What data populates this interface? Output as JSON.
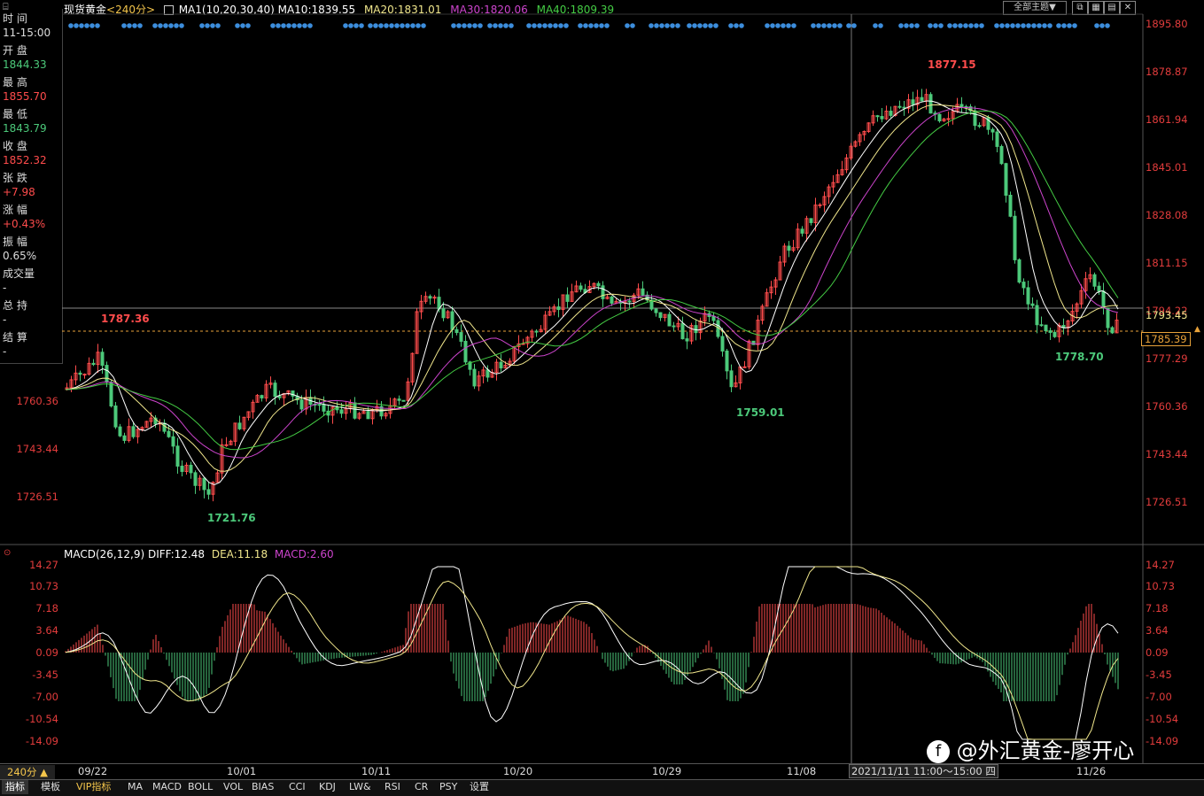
{
  "header": {
    "symbol": "现货黄金",
    "period": "<240分>",
    "ma_label": "MA1(10,20,30,40)",
    "ma10": "MA10:1839.55",
    "ma20": "MA20:1831.01",
    "ma30": "MA30:1820.06",
    "ma40": "MA40:1809.39",
    "theme_select": "全部主题▼",
    "window_icons": [
      "restore-icon",
      "grid-icon",
      "tile-icon",
      "close-icon"
    ]
  },
  "info_panel": {
    "time_label": "时 间",
    "time_value": "11-15:00",
    "open_label": "开 盘",
    "open_value": "1844.33",
    "high_label": "最 高",
    "high_value": "1855.70",
    "low_label": "最 低",
    "low_value": "1843.79",
    "close_label": "收 盘",
    "close_value": "1852.32",
    "change_label": "张 跌",
    "change_value": "+7.98",
    "pct_label": "涨 幅",
    "pct_value": "+0.43%",
    "amp_label": "振 幅",
    "amp_value": "0.65%",
    "vol_label": "成交量",
    "vol_value": "-",
    "oi_label": "总 持",
    "oi_value": "-",
    "settle_label": "结 算",
    "settle_value": "-"
  },
  "price_axis": [
    "1895.80",
    "1878.87",
    "1861.94",
    "1845.01",
    "1828.08",
    "1811.15",
    "1794.22",
    "1777.29",
    "1760.36",
    "1743.44",
    "1726.51"
  ],
  "left_axis": [
    "1760.36",
    "1743.44",
    "1726.51"
  ],
  "price_marks": {
    "current": "1793.45",
    "last": "1785.39",
    "high_note": "1877.15",
    "low_note": "1721.76",
    "note_1787": "1787.36",
    "note_1759": "1759.01",
    "note_1778": "1778.70"
  },
  "macd": {
    "label": "MACD(26,12,9)",
    "diff": "DIFF:12.48",
    "dea": "DEA:11.18",
    "macd": "MACD:2.60",
    "axis": [
      "14.27",
      "10.73",
      "7.18",
      "3.64",
      "0.09",
      "-3.45",
      "-7.00",
      "-10.54",
      "-14.09"
    ]
  },
  "x_axis": {
    "period_label": "240分 ▲",
    "dates": [
      "09/22",
      "10/01",
      "10/11",
      "10/20",
      "10/29",
      "11/08",
      "11/26"
    ],
    "cursor_time": "2021/11/11 11:00～15:00 四"
  },
  "tabs": [
    "指标",
    "模板",
    "VIP指标",
    "MA",
    "MACD",
    "BOLL",
    "VOL",
    "BIAS",
    "CCI",
    "KDJ",
    "LW&",
    "RSI",
    "CR",
    "PSY",
    "设置"
  ],
  "watermark": "@外汇黄金-廖开心",
  "colors": {
    "up": "#ff4c4c",
    "down": "#4cc97a",
    "ma10": "#ffffff",
    "ma20": "#f0e68c",
    "ma30": "#cc44cc",
    "ma40": "#44cc44",
    "macd_up": "#ff4c4c",
    "macd_down": "#4cc97a"
  }
}
